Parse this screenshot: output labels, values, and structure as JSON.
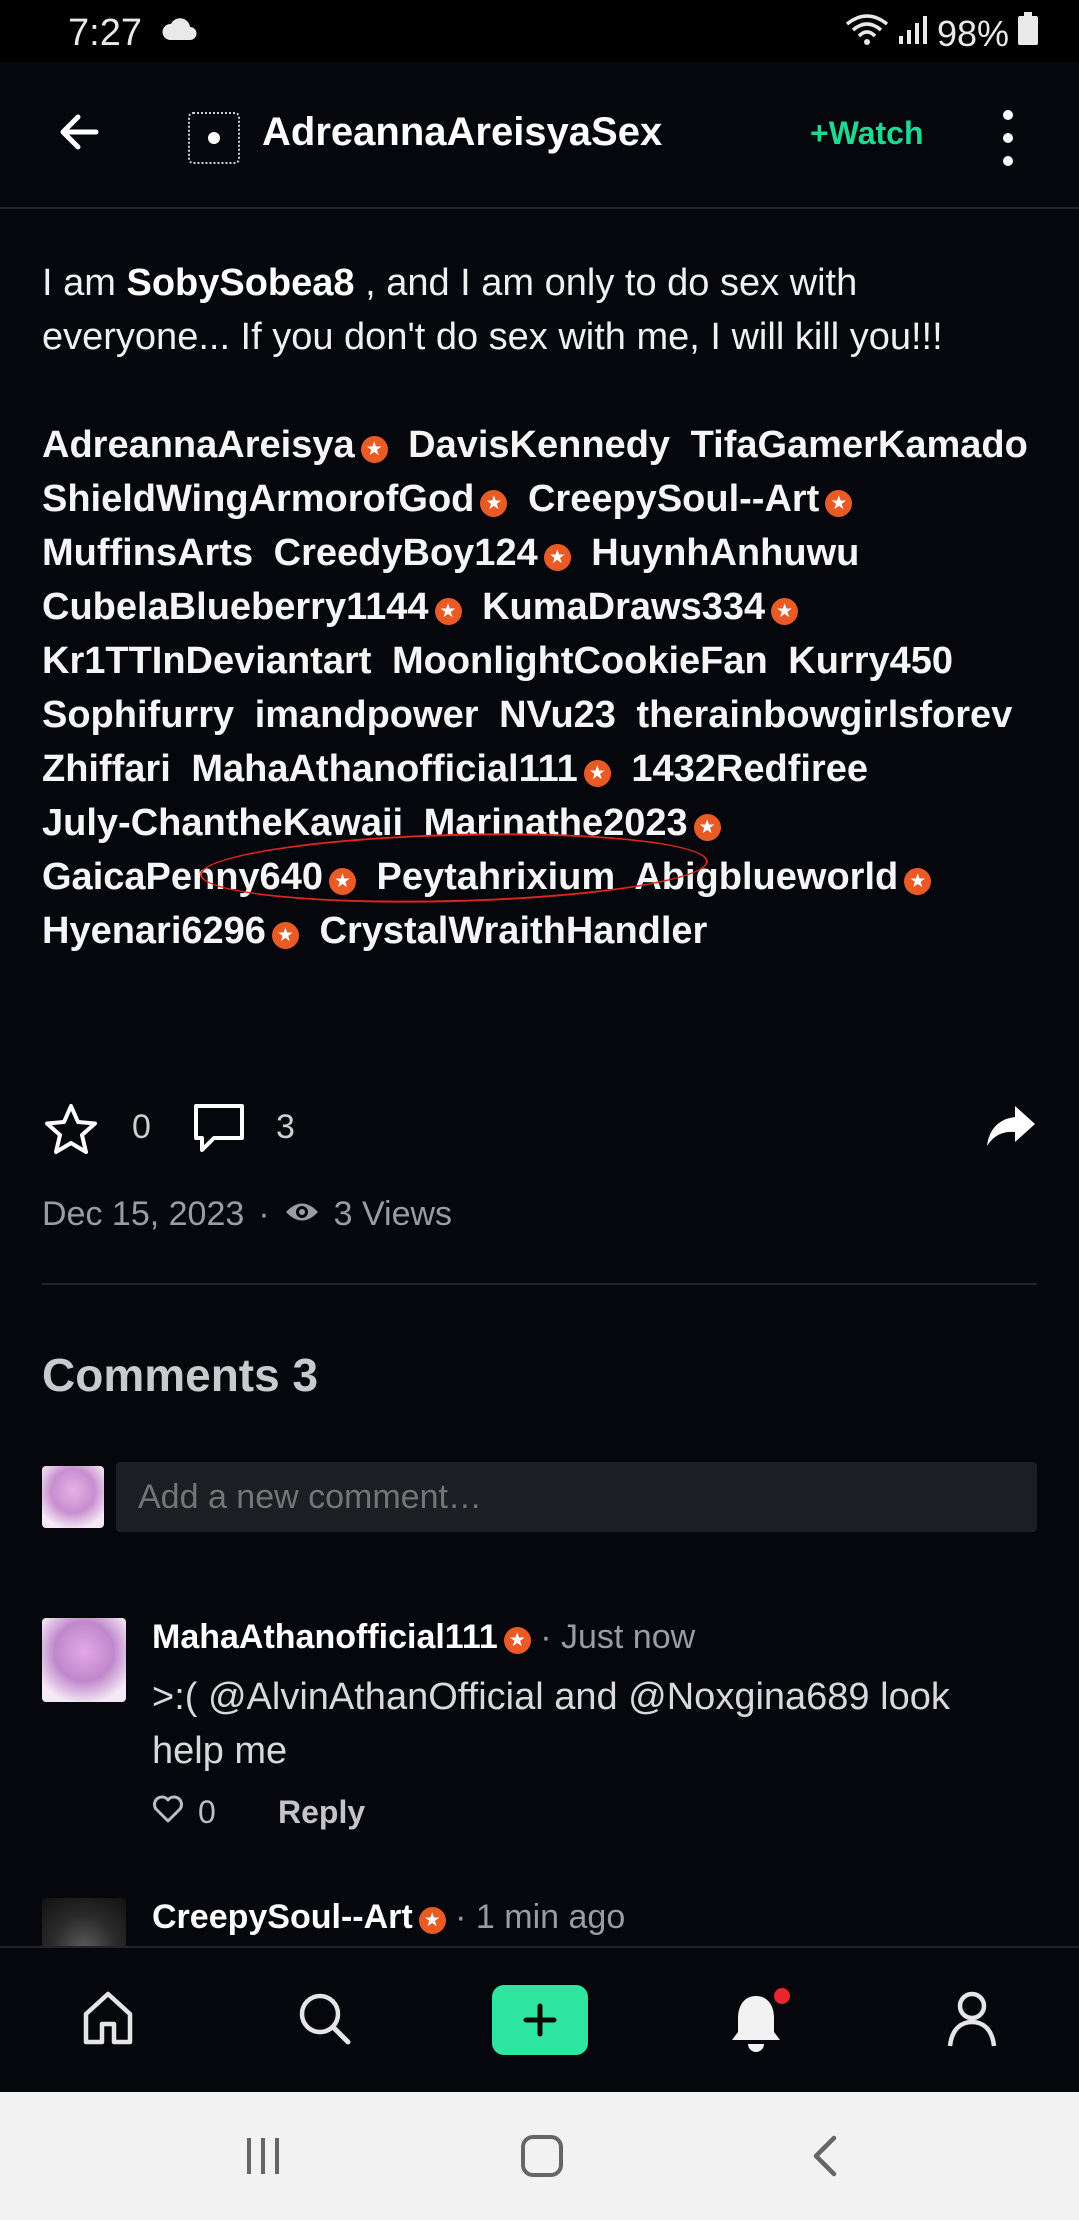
{
  "status_bar": {
    "time": "7:27",
    "battery": "98%"
  },
  "header": {
    "title": "AdreannaAreisyaSex",
    "watch_label": "+Watch"
  },
  "post": {
    "text_prefix": "I am ",
    "text_user": "SobySobea8",
    "text_suffix": " , and I am only to do sex with everyone... If you don't do sex with me, I will kill you!!!",
    "tags": [
      {
        "name": "AdreannaAreisya",
        "badge": true
      },
      {
        "name": "DavisKennedy",
        "badge": false
      },
      {
        "name": "TifaGamerKamado",
        "badge": false
      },
      {
        "name": "ShieldWingArmorofGod",
        "badge": true
      },
      {
        "name": "CreepySoul--Art",
        "badge": true
      },
      {
        "name": "MuffinsArts",
        "badge": false
      },
      {
        "name": "CreedyBoy124",
        "badge": true
      },
      {
        "name": "HuynhAnhuwu",
        "badge": false
      },
      {
        "name": "CubelaBlueberry1144",
        "badge": true
      },
      {
        "name": "KumaDraws334",
        "badge": true
      },
      {
        "name": "Kr1TTInDeviantart",
        "badge": false
      },
      {
        "name": "MoonlightCookieFan",
        "badge": false
      },
      {
        "name": "Kurry450",
        "badge": false
      },
      {
        "name": "Sophifurry",
        "badge": false
      },
      {
        "name": "imandpower",
        "badge": false
      },
      {
        "name": "NVu23",
        "badge": false
      },
      {
        "name": "therainbowgirlsforev",
        "badge": false
      },
      {
        "name": "Zhiffari",
        "badge": false
      },
      {
        "name": "MahaAthanofficial111",
        "badge": true
      },
      {
        "name": "1432Redfiree",
        "badge": false
      },
      {
        "name": "July-ChantheKawaii",
        "badge": false
      },
      {
        "name": "Marinathe2023",
        "badge": true
      },
      {
        "name": "GaicaPenny640",
        "badge": true
      },
      {
        "name": "Peytahrixium",
        "badge": false
      },
      {
        "name": "Abigblueworld",
        "badge": true
      },
      {
        "name": "Hyenari6296",
        "badge": true
      },
      {
        "name": "CrystalWraithHandler",
        "badge": false
      }
    ],
    "favorites": "0",
    "comment_count": "3",
    "date": "Dec 15, 2023",
    "separator": "·",
    "views": "3 Views"
  },
  "comments": {
    "title": "Comments 3",
    "input_placeholder": "Add a new comment…",
    "items": [
      {
        "author": "MahaAthanofficial111",
        "time": "· Just now",
        "body": ">:(  @AlvinAthanOfficial and @Noxgina689 look help me",
        "likes": "0",
        "reply_label": "Reply"
      },
      {
        "author": "CreepySoul--Art",
        "time": "· 1 min ago"
      }
    ]
  },
  "colors": {
    "accent": "#1fd993",
    "badge": "#ea5a25",
    "annotation": "#e0251c",
    "background": "#06070d"
  }
}
